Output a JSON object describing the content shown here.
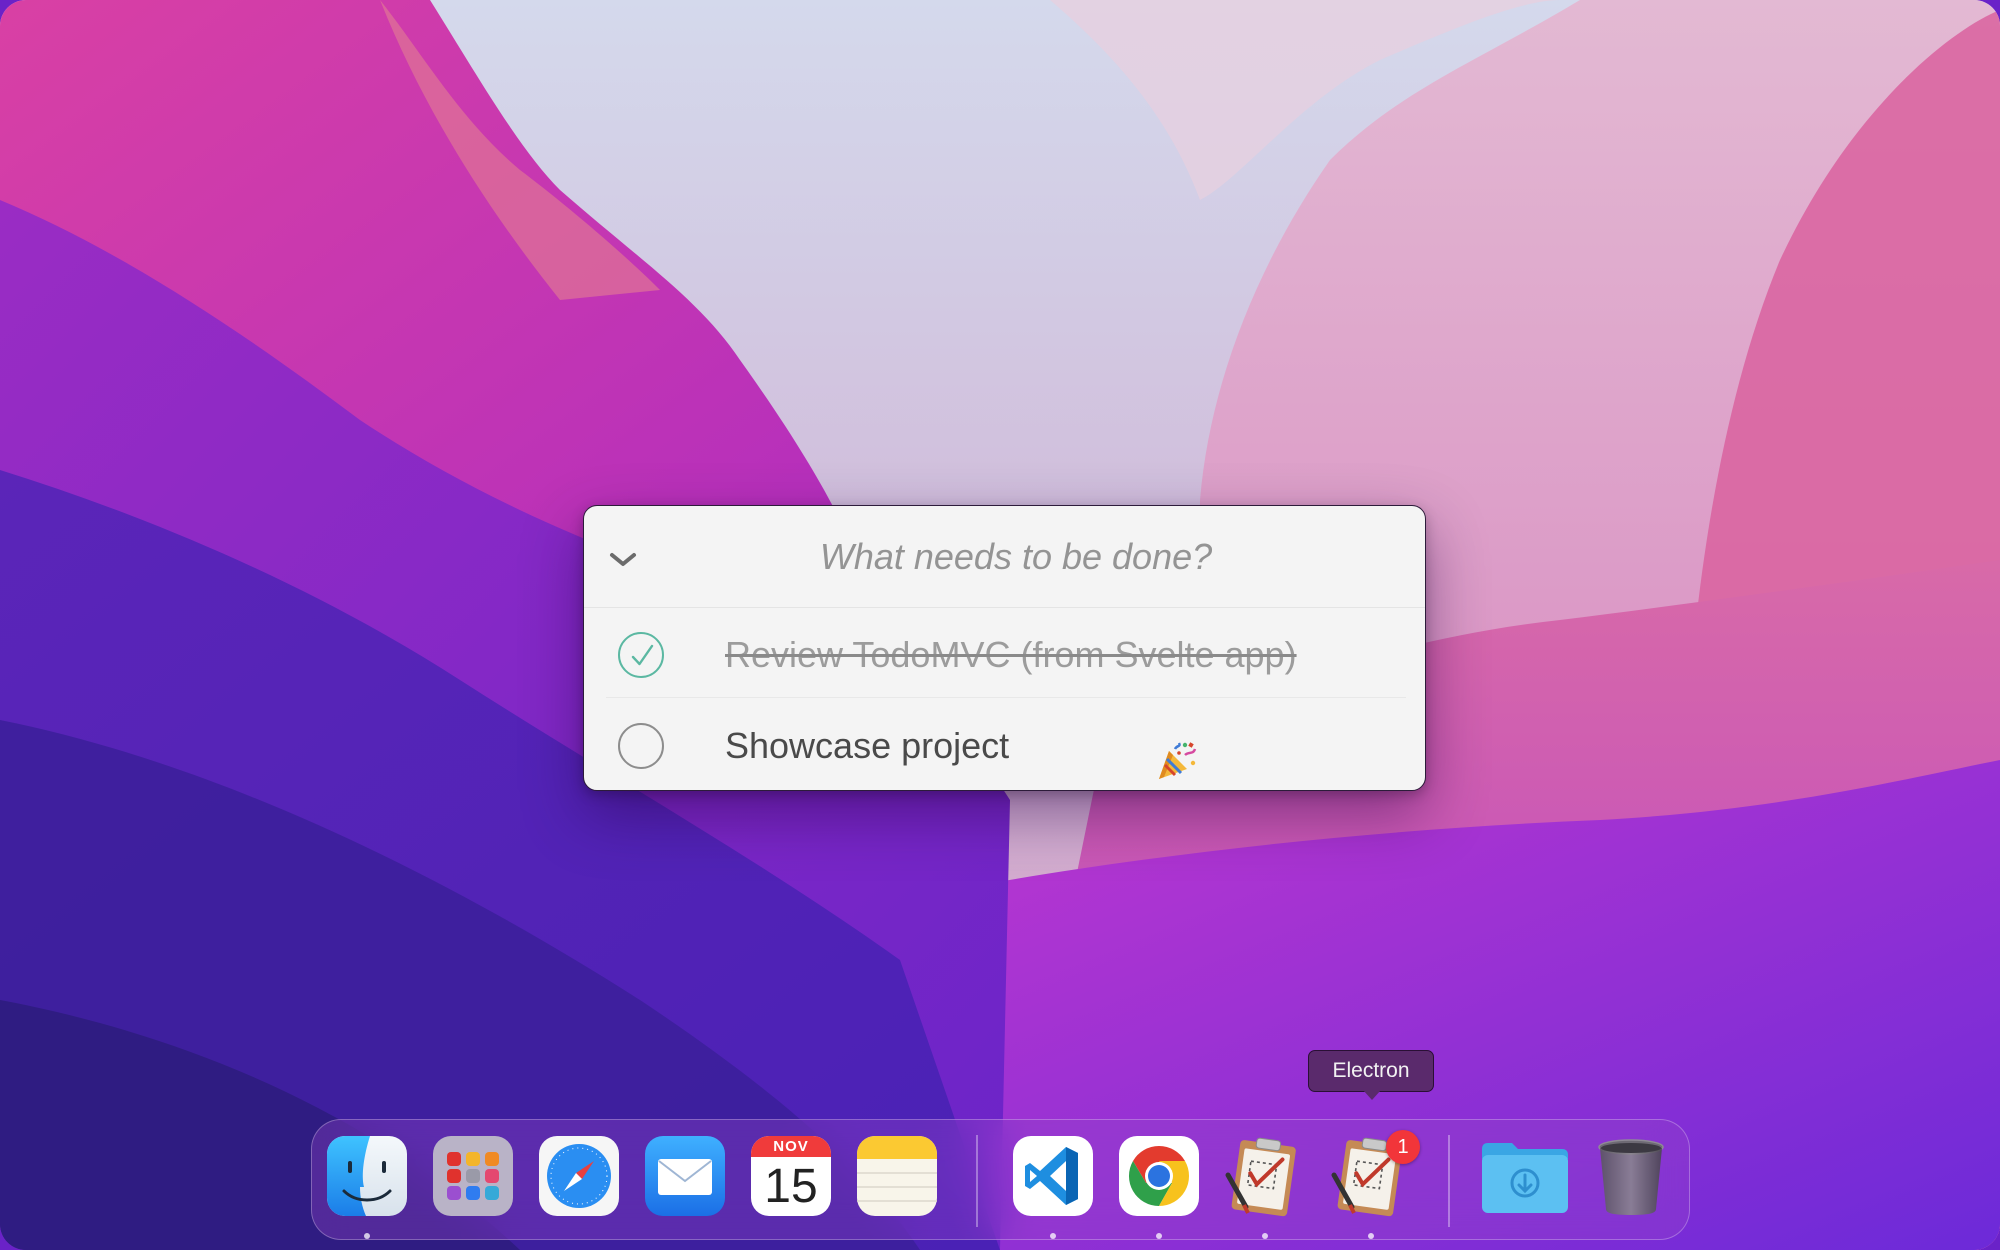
{
  "todo": {
    "input_placeholder": "What needs to be done?",
    "items": [
      {
        "title": "Review TodoMVC (from Svelte app)",
        "completed": true
      },
      {
        "title": "Showcase project",
        "completed": false,
        "emoji_icon": "party-popper-icon"
      }
    ]
  },
  "dock": {
    "apps": [
      {
        "name": "Finder",
        "icon": "finder-icon",
        "running": true
      },
      {
        "name": "Launchpad",
        "icon": "launchpad-icon",
        "running": false
      },
      {
        "name": "Safari",
        "icon": "safari-icon",
        "running": false
      },
      {
        "name": "Mail",
        "icon": "mail-icon",
        "running": false
      },
      {
        "name": "Calendar",
        "icon": "calendar-icon",
        "running": false,
        "month": "NOV",
        "day": "15"
      },
      {
        "name": "Notes",
        "icon": "notes-icon",
        "running": false
      },
      {
        "name": "Visual Studio Code",
        "icon": "vscode-icon",
        "running": true
      },
      {
        "name": "Google Chrome",
        "icon": "chrome-icon",
        "running": true
      },
      {
        "name": "Todo app",
        "icon": "clipboard-todo-icon",
        "running": true
      },
      {
        "name": "Electron",
        "icon": "clipboard-todo-icon",
        "running": true,
        "badge": "1"
      },
      {
        "name": "Downloads",
        "icon": "downloads-folder-icon",
        "running": false
      },
      {
        "name": "Trash",
        "icon": "trash-icon",
        "running": false
      }
    ],
    "tooltip": "Electron"
  },
  "colors": {
    "check_done": "#5bb8a2",
    "badge": "#f2353a",
    "tooltip_bg": "#5a2a6c"
  }
}
